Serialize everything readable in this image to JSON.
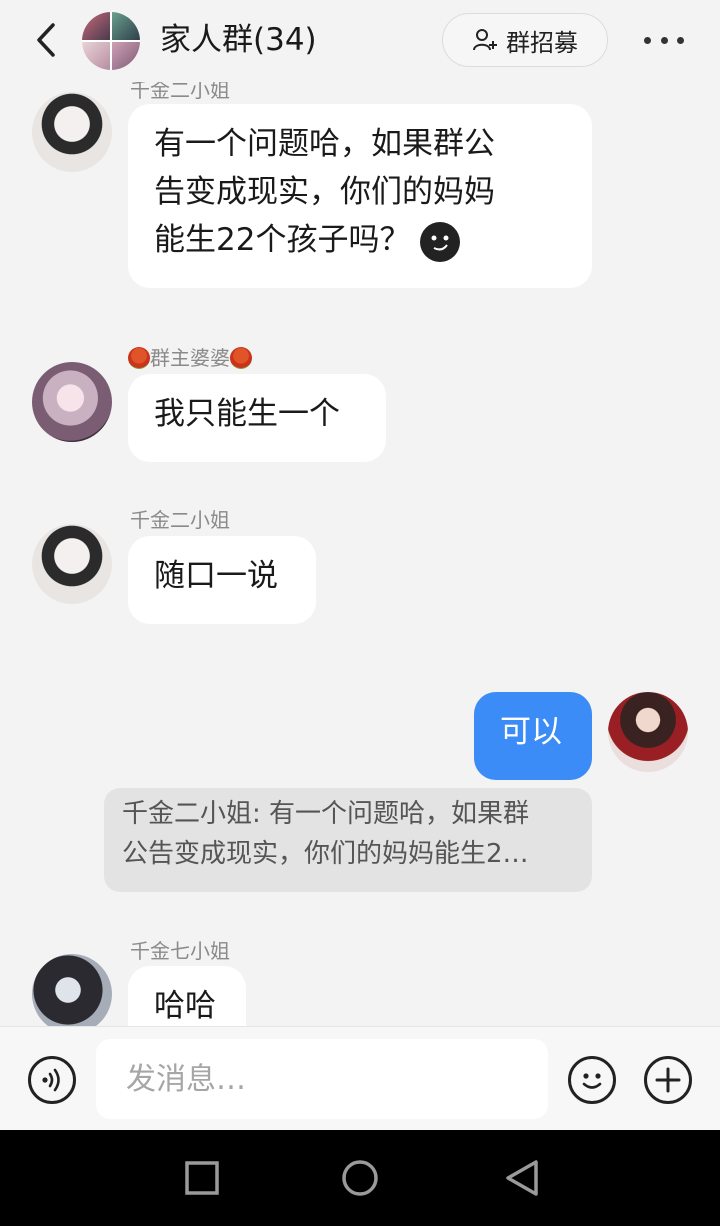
{
  "header": {
    "back_icon": "chevron-left-icon",
    "title": "家人群(34)",
    "recruit_label": "群招募",
    "recruit_icon": "add-person-icon",
    "more_icon": "more-dots-icon"
  },
  "messages": [
    {
      "sender": "千金二小姐",
      "text_lines": [
        "有一个问题哈，如果群公",
        "告变成现实，你们的妈妈",
        "能生22个孩子吗？"
      ],
      "emoji": "smirk-emoji-icon"
    },
    {
      "sender": "群主婆婆",
      "sender_icon": "rose-icon",
      "text": "我只能生一个"
    },
    {
      "sender": "千金二小姐",
      "text": "随口一说"
    },
    {
      "sender": "me",
      "text": "可以",
      "quote_lines": [
        "千金二小姐: 有一个问题哈，如果群",
        "公告变成现实，你们的妈妈能生2…"
      ]
    },
    {
      "sender": "千金七小姐",
      "text": "哈哈"
    }
  ],
  "input_bar": {
    "voice_icon": "voice-icon",
    "placeholder": "发消息…",
    "emoji_icon": "smile-icon",
    "plus_icon": "plus-icon"
  },
  "nav": {
    "recent_icon": "square-icon",
    "home_icon": "circle-icon",
    "back_icon": "triangle-back-icon"
  },
  "colors": {
    "accent": "#3b8cf7",
    "background": "#f3f3f3",
    "bubble": "#ffffff",
    "quote": "#e3e3e3"
  }
}
